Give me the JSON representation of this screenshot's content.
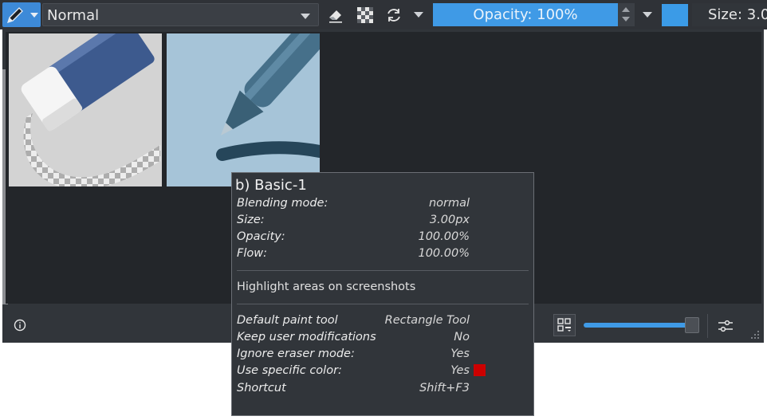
{
  "toolbar": {
    "blend_mode": "Normal",
    "opacity_label": "Opacity: 100%",
    "opacity_value": 1.0,
    "size_label": "Size: 3.0",
    "accent_color": "#3f9ae6",
    "current_color": "#3b9be7",
    "icons": [
      "brush-icon",
      "eraser-icon",
      "checker-alpha-icon",
      "reload-icon"
    ]
  },
  "presets": [
    {
      "name": "eraser-preset"
    },
    {
      "name": "basic-1-preset"
    }
  ],
  "panel_footer": {
    "zoom_value": 0.95,
    "icons": [
      "info-icon",
      "view-mode-icon",
      "settings-sliders-icon"
    ]
  },
  "tooltip": {
    "title": "b) Basic-1",
    "properties": [
      {
        "key": "Blending mode:",
        "value": "normal"
      },
      {
        "key": "Size:",
        "value": "3.00px"
      },
      {
        "key": "Opacity:",
        "value": "100.00%"
      },
      {
        "key": "Flow:",
        "value": "100.00%"
      }
    ],
    "description": "Highlight areas on screenshots",
    "options": [
      {
        "key": "Default paint tool",
        "value": "Rectangle Tool"
      },
      {
        "key": "Keep user modifications",
        "value": "No"
      },
      {
        "key": "Ignore eraser mode:",
        "value": "Yes"
      },
      {
        "key": "Use specific color:",
        "value": "Yes"
      },
      {
        "key": "Shortcut",
        "value": "Shift+F3"
      }
    ],
    "specific_color": "#cc0000"
  }
}
